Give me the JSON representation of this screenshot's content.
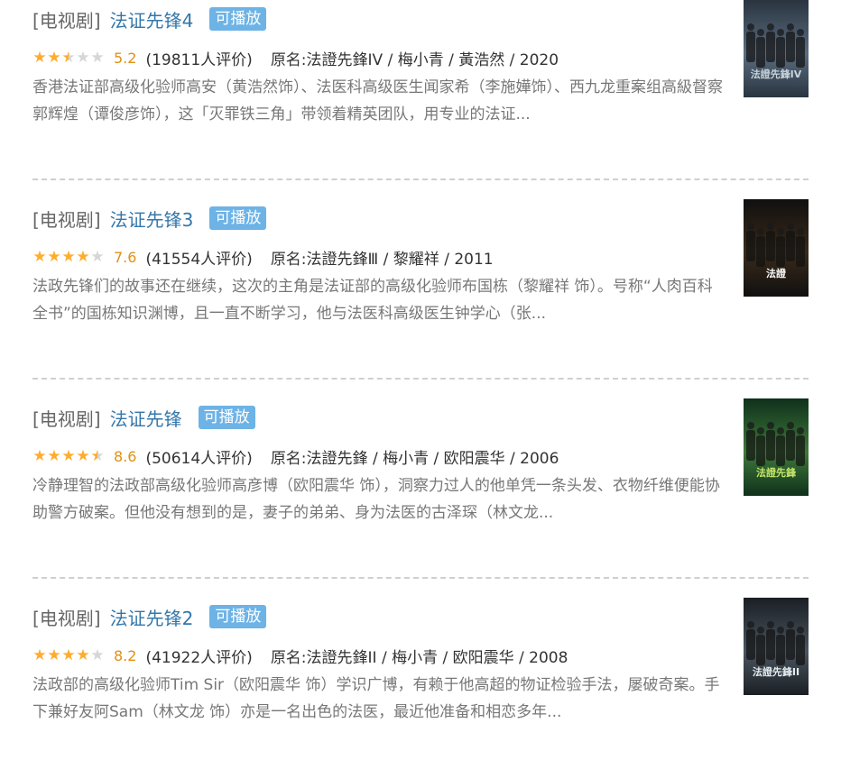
{
  "items": [
    {
      "category": "[电视剧]",
      "title": "法证先锋4",
      "badge": "可播放",
      "stars": 2.5,
      "rating": "5.2",
      "votes": "(19811人评价)",
      "original": "原名:法證先鋒IV / 梅小青 / 黃浩然 / 2020",
      "description": "香港法证部高级化验师高安（黄浩然饰）、法医科高级医生闻家希（李施嬅饰）、西九龙重案组高級督察郭辉煌（谭俊彦饰），这「灭罪铁三角」带领着精英团队，用专业的法证...",
      "poster_text": "法證先鋒IV",
      "poster_colors": [
        "#2a3440",
        "#5a6d80",
        "#c8d4dc"
      ]
    },
    {
      "category": "[电视剧]",
      "title": "法证先锋3",
      "badge": "可播放",
      "stars": 4,
      "rating": "7.6",
      "votes": "(41554人评价)",
      "original": "原名:法證先鋒Ⅲ / 黎耀祥 / 2011",
      "description": "法政先锋们的故事还在继续，这次的主角是法证部的高级化验师布国栋（黎耀祥 饰）。号称“人肉百科全书”的国栋知识渊博，且一直不断学习，他与法医科高级医生钟学心（张...",
      "poster_text": "法證",
      "poster_colors": [
        "#101010",
        "#3a2a1a",
        "#ffffff"
      ]
    },
    {
      "category": "[电视剧]",
      "title": "法证先锋",
      "badge": "可播放",
      "stars": 4.5,
      "rating": "8.6",
      "votes": "(50614人评价)",
      "original": "原名:法證先鋒 / 梅小青 / 欧阳震华 / 2006",
      "description": "冷静理智的法政部高级化验师高彦博（欧阳震华 饰），洞察力过人的他单凭一条头发、衣物纤维便能协助警方破案。但他没有想到的是，妻子的弟弟、身为法医的古泽琛（林文龙...",
      "poster_text": "法證先鋒",
      "poster_colors": [
        "#10301c",
        "#3e7a3a",
        "#c7e86a"
      ]
    },
    {
      "category": "[电视剧]",
      "title": "法证先锋2",
      "badge": "可播放",
      "stars": 4,
      "rating": "8.2",
      "votes": "(41922人评价)",
      "original": "原名:法證先鋒II / 梅小青 / 欧阳震华 / 2008",
      "description": "法政部的高级化验师Tim Sir（欧阳震华 饰）学识广博，有赖于他高超的物证检验手法，屡破奇案。手下兼好友阿Sam（林文龙 饰）亦是一名出色的法医，最近他准备和相恋多年...",
      "poster_text": "法證先鋒II",
      "poster_colors": [
        "#1a1f24",
        "#4b5560",
        "#e6eef2"
      ]
    }
  ],
  "colors": {
    "star_on": "#ffac2d",
    "star_off": "#d6d6d6",
    "link": "#3377aa",
    "badge": "#6db3e6"
  }
}
